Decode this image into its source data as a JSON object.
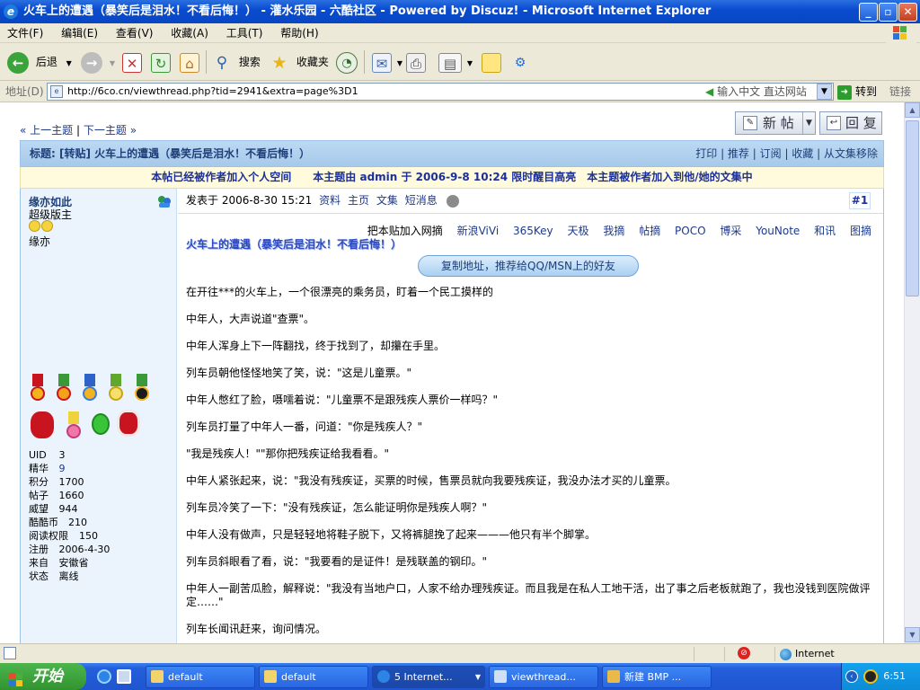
{
  "window": {
    "title": "火车上的遭遇（暴笑后是泪水！不看后悔！） - 灌水乐园 - 六酷社区 - Powered by Discuz! - Microsoft Internet Explorer"
  },
  "menu": [
    "文件(F)",
    "编辑(E)",
    "查看(V)",
    "收藏(A)",
    "工具(T)",
    "帮助(H)"
  ],
  "toolbar": {
    "back": "后退",
    "search": "搜索",
    "favorites": "收藏夹"
  },
  "address": {
    "label": "地址(D)",
    "url": "http://6co.cn/viewthread.php?tid=2941&extra=page%3D1",
    "hint": "输入中文 直达网站",
    "go": "转到",
    "links": "链接"
  },
  "page": {
    "prev_topic": "上一主题",
    "next_topic": "下一主题",
    "new_post": "新 帖",
    "reply": "回 复",
    "thread_title": "标题: [转贴] 火车上的遭遇（暴笑后是泪水！不看后悔！）",
    "actions": [
      "打印",
      "推荐",
      "订阅",
      "收藏",
      "从文集移除"
    ],
    "notice": "本帖已经被作者加入个人空间　　本主题由 admin 于 2006-9-8 10:24 限时醒目高亮　本主题被作者加入到他/她的文集中"
  },
  "author": {
    "name": "缘亦如此",
    "rank": "超级版主",
    "nickname": "缘亦",
    "stats": [
      {
        "label": "UID",
        "value": "3"
      },
      {
        "label": "精华",
        "value": "9"
      },
      {
        "label": "积分",
        "value": "1700"
      },
      {
        "label": "帖子",
        "value": "1660"
      },
      {
        "label": "威望",
        "value": "944"
      },
      {
        "label": "酷酷币",
        "value": "210"
      },
      {
        "label": "阅读权限",
        "value": "150"
      },
      {
        "label": "注册",
        "value": "2006-4-30"
      },
      {
        "label": "来自",
        "value": "安徽省"
      },
      {
        "label": "状态",
        "value": "离线"
      }
    ]
  },
  "post": {
    "posted_at": "发表于 2006-8-30 15:21",
    "links": [
      "资料",
      "主页",
      "文集",
      "短消息"
    ],
    "floor": "#1",
    "share_intro": "把本贴加入网摘",
    "share_sites": [
      "新浪ViVi",
      "365Key",
      "天极",
      "我摘",
      "帖摘",
      "POCO",
      "博采",
      "YouNote",
      "和讯",
      "图摘"
    ],
    "title": "火车上的遭遇（暴笑后是泪水！不看后悔！）",
    "copy_button": "复制地址，推荐给QQ/MSN上的好友",
    "paragraphs": [
      "在开往***的火车上，一个很漂亮的乘务员，盯着一个民工摸样的",
      "中年人，大声说道\"查票\"。",
      "中年人浑身上下一阵翻找，终于找到了，却攥在手里。",
      "列车员朝他怪怪地笑了笑，说：\"这是儿童票。\"",
      "中年人憋红了脸，嗫嚅着说：\"儿童票不是跟残疾人票价一样吗？\"",
      "列车员打量了中年人一番，问道：\"你是残疾人？\"",
      "\"我是残疾人！\"\"那你把残疾证给我看看。\"",
      "中年人紧张起来，说：\"我没有残疾证，买票的时候，售票员就向我要残疾证，我没办法才买的儿童票。",
      "列车员冷笑了一下：\"没有残疾证，怎么能证明你是残疾人啊？\"",
      "中年人没有做声，只是轻轻地将鞋子脱下，又将裤腿挽了起来———他只有半个脚掌。",
      "列车员斜眼看了看，说：\"我要看的是证件！是残联盖的钢印。\"",
      "中年人一副苦瓜脸，解释说：\"我没有当地户口，人家不给办理残疾证。而且我是在私人工地干活，出了事之后老板就跑了，我也没钱到医院做评定……\"",
      "列车长闻讯赶来，询问情况。"
    ]
  },
  "status": {
    "zone": "Internet"
  },
  "taskbar": {
    "start": "开始",
    "tasks": [
      "default",
      "default",
      "5 Internet...",
      "viewthread...",
      "新建 BMP ..."
    ],
    "clock": "6:51"
  },
  "colors": {
    "title_bar": "#0a4cd0",
    "thread_header": "#a7c9ea",
    "notice_bg": "#fffbdc",
    "link": "#1d3a8a"
  }
}
